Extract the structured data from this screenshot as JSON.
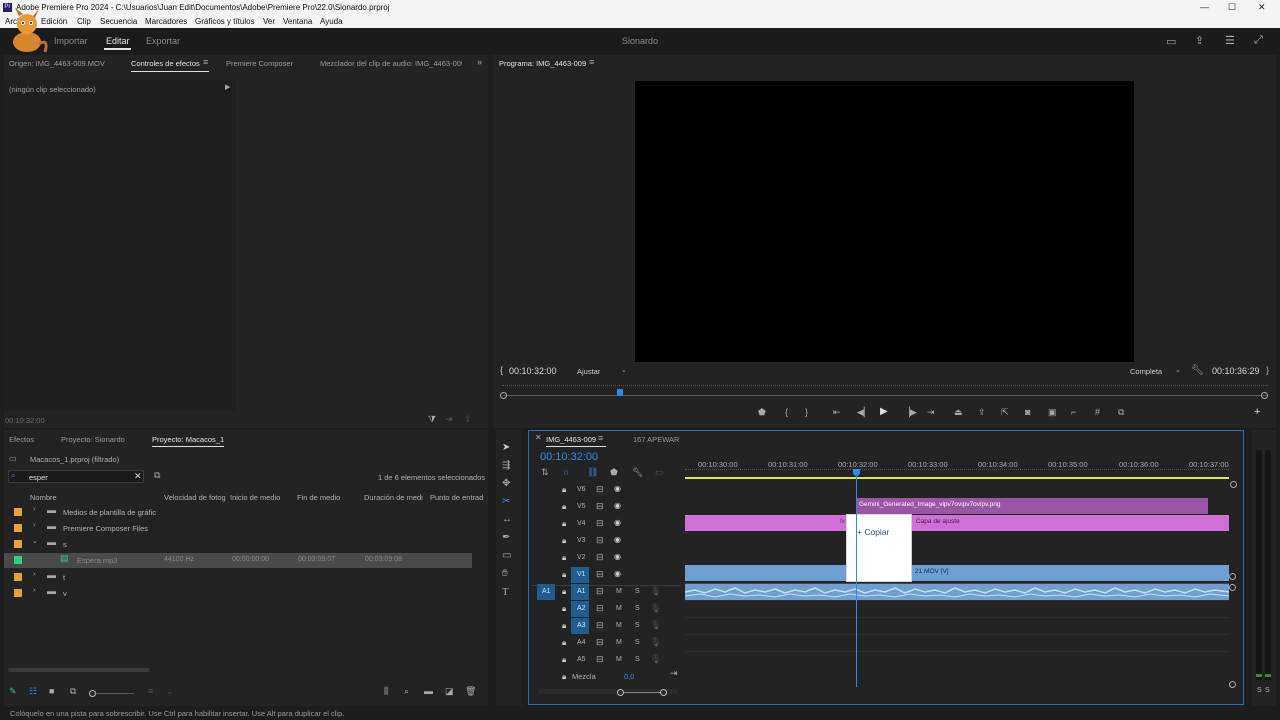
{
  "title_bar": {
    "app_badge": "Pr",
    "title": "Adobe Premiere Pro 2024 - C:\\Usuarios\\Juan Edit\\Documentos\\Adobe\\Premiere Pro\\22.0\\Sionardo.prproj",
    "minimize": "—",
    "maximize": "☐",
    "close": "✕"
  },
  "menu": [
    "Archivo",
    "Edición",
    "Clip",
    "Secuencia",
    "Marcadores",
    "Gráficos y títulos",
    "Ver",
    "Ventana",
    "Ayuda"
  ],
  "header": {
    "tabs": [
      "Importar",
      "Editar",
      "Exportar"
    ],
    "active_tab": "Editar",
    "project_name": "Sionardo"
  },
  "source_panel": {
    "tabs": [
      "Origen: IMG_4463-009.MOV",
      "Controles de efectos",
      "Premiere Composer",
      "Mezclador del clip de audio: IMG_4463-009"
    ],
    "active_tab": "Controles de efectos",
    "no_clip": "(ningún clip seleccionado)",
    "timecode": "00:10:32:00"
  },
  "program_panel": {
    "title": "Programa: IMG_4463-009",
    "timecode_left": "00:10:32:00",
    "fit": "Ajustar",
    "quality": "Completa",
    "timecode_right": "00:10:36:29",
    "playhead_fraction": 0.153
  },
  "project_panel": {
    "tabs": [
      "Efectos",
      "Proyecto: Sionardo",
      "Proyecto: Macacos_1"
    ],
    "active_tab": "Proyecto: Macacos_1",
    "path": "Macacos_1.prproj (filtrado)",
    "search_value": "esper",
    "selection_count": "1 de 6 elementos seleccionados",
    "columns": [
      "Nombre",
      "Velocidad de fotog",
      "Inicio de medio",
      "Fin de medio",
      "Duración de medi",
      "Punto de entrad"
    ],
    "rows": [
      {
        "name": "Medios de plantilla de gráfic",
        "type": "folder",
        "indent": 1,
        "expanded": false
      },
      {
        "name": "Premiere Composer Files",
        "type": "folder",
        "indent": 1,
        "expanded": false
      },
      {
        "name": "s",
        "type": "folder",
        "indent": 1,
        "expanded": true
      },
      {
        "name": "Espera.mp3",
        "type": "audio",
        "indent": 3,
        "fps": "44100 Hz",
        "start": "00:00:00:00",
        "end": "00:03:09:07",
        "duration": "00:03:09:08",
        "selected": true
      },
      {
        "name": "t",
        "type": "folder",
        "indent": 1,
        "expanded": false
      },
      {
        "name": "v",
        "type": "folder",
        "indent": 1,
        "expanded": false
      }
    ],
    "colors": {
      "folder": "#e8a33c",
      "audio": "#2fd07a"
    }
  },
  "timeline": {
    "tabs": [
      "IMG_4463-009",
      "167 APEWAR"
    ],
    "timecode": "00:10:32:00",
    "ruler": [
      "00:10:30:00",
      "00:10:31:00",
      "00:10:32:00",
      "00:10:33:00",
      "00:10:34:00",
      "00:10:35:00",
      "00:10:36:00",
      "00:10:37:00"
    ],
    "video_tracks": [
      "V6",
      "V5",
      "V4",
      "V3",
      "V2",
      "V1"
    ],
    "audio_tracks": [
      "A1",
      "A2",
      "A3",
      "A4",
      "A5"
    ],
    "source_patch": "A1",
    "mix_label": "Mezcla",
    "mix_value": "0,0",
    "clips": {
      "v5": "Gemini_Generated_Image_vipv7ovipv7ovipv.png",
      "v4": "Capa de ajuste",
      "v1": "21.MOV [V]",
      "v4_fx": "fx"
    },
    "drag_tooltip": "Copiar",
    "colors": {
      "video_clip": "#d070d6",
      "image_clip": "#9b55a7",
      "v1_clip": "#6f9fd0",
      "audio_clip": "#6f9fd0",
      "accent": "#2d8ceb"
    }
  },
  "meters": {
    "labels": [
      "S",
      "S"
    ]
  },
  "status": "Colóquelo en una pista para sobrescribir. Use Ctrl para habilitar insertar. Use Alt para duplicar el clip."
}
